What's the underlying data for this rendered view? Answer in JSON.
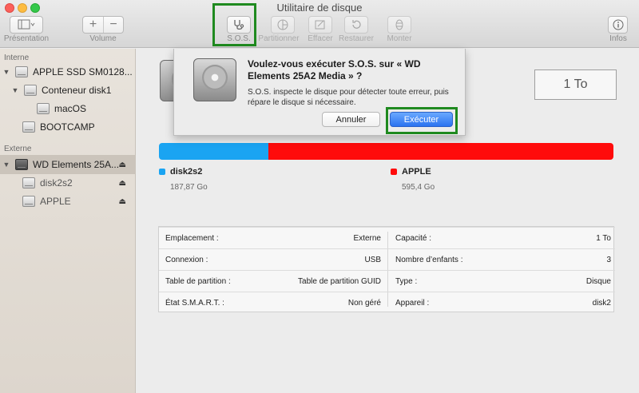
{
  "window": {
    "title": "Utilitaire de disque"
  },
  "toolbar": {
    "presentation_label": "Présentation",
    "volume_label": "Volume",
    "volume_add_glyph": "+",
    "volume_remove_glyph": "−",
    "sos_label": "S.O.S.",
    "partition_label": "Partitionner",
    "erase_label": "Effacer",
    "restore_label": "Restaurer",
    "mount_label": "Monter",
    "info_label": "Infos",
    "icons": [
      "sidebar-icon",
      "stethoscope-icon",
      "pie-icon",
      "erase-icon",
      "restore-icon",
      "mount-icon",
      "info-icon"
    ]
  },
  "sidebar": {
    "internal_header": "Interne",
    "external_header": "Externe",
    "items": [
      {
        "label": "APPLE SSD SM0128..."
      },
      {
        "label": "Conteneur disk1"
      },
      {
        "label": "macOS"
      },
      {
        "label": "BOOTCAMP"
      },
      {
        "label": "WD Elements 25A..."
      },
      {
        "label": "disk2s2"
      },
      {
        "label": "APPLE"
      }
    ],
    "eject_glyph": "⏏"
  },
  "main": {
    "capacity_badge": "1 To",
    "usage": {
      "segments": [
        {
          "name": "disk2s2",
          "size": "187,87 Go",
          "color": "#1aa4f2",
          "fraction": 0.24
        },
        {
          "name": "APPLE",
          "size": "595,4 Go",
          "color": "#ff0b0b",
          "fraction": 0.76
        }
      ]
    },
    "info_rows": [
      {
        "left_key": "Emplacement :",
        "left_val": "Externe",
        "right_key": "Capacité :",
        "right_val": "1 To"
      },
      {
        "left_key": "Connexion :",
        "left_val": "USB",
        "right_key": "Nombre d’enfants :",
        "right_val": "3"
      },
      {
        "left_key": "Table de partition :",
        "left_val": "Table de partition GUID",
        "right_key": "Type :",
        "right_val": "Disque"
      },
      {
        "left_key": "État S.M.A.R.T. :",
        "left_val": "Non géré",
        "right_key": "Appareil :",
        "right_val": "disk2"
      }
    ]
  },
  "dialog": {
    "title": "Voulez-vous exécuter S.O.S. sur « WD Elements 25A2 Media » ?",
    "body": "S.O.S. inspecte le disque pour détecter toute erreur, puis répare le disque si nécessaire.",
    "cancel_label": "Annuler",
    "run_label": "Exécuter"
  },
  "highlight_color": "#1f8a1f"
}
